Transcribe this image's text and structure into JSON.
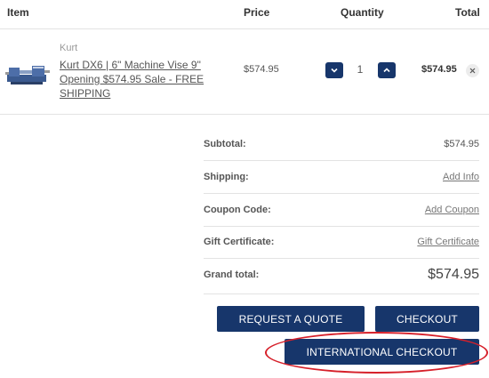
{
  "cart": {
    "headers": {
      "item": "Item",
      "price": "Price",
      "quantity": "Quantity",
      "total": "Total"
    },
    "item": {
      "brand": "Kurt",
      "name": "Kurt DX6 | 6\" Machine Vise 9\" Opening $574.95 Sale - FREE SHIPPING",
      "price": "$574.95",
      "quantity": "1",
      "total": "$574.95",
      "thumbnail_icon": "machine-vise-image"
    }
  },
  "summary": {
    "subtotal_label": "Subtotal:",
    "subtotal_value": "$574.95",
    "shipping_label": "Shipping:",
    "shipping_link": "Add Info",
    "coupon_label": "Coupon Code:",
    "coupon_link": "Add Coupon",
    "gift_label": "Gift Certificate:",
    "gift_link": "Gift Certificate",
    "grand_label": "Grand total:",
    "grand_value": "$574.95"
  },
  "actions": {
    "quote_label": "REQUEST A QUOTE",
    "checkout_label": "CHECKOUT",
    "intl_label": "INTERNATIONAL CHECKOUT"
  },
  "colors": {
    "button": "#17366b",
    "highlight": "#d6202a"
  }
}
